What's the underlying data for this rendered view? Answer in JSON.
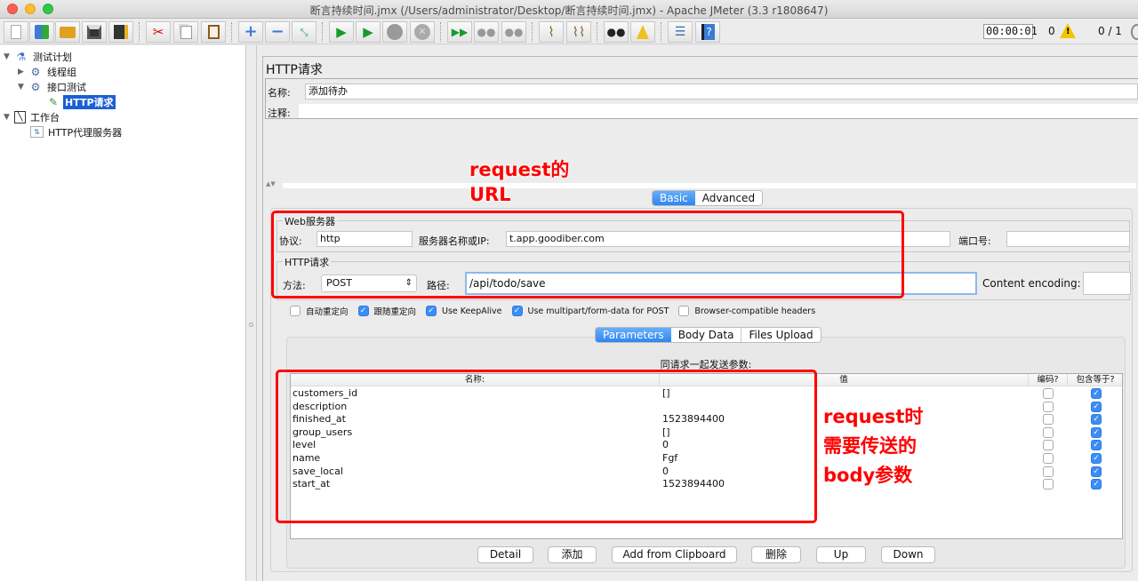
{
  "window": {
    "title": "断言持续时间.jmx (/Users/administrator/Desktop/断言持续时间.jmx) - Apache JMeter (3.3 r1808647)"
  },
  "toolbar": {
    "buttons": [
      {
        "name": "new",
        "icon": "new-document-icon"
      },
      {
        "name": "templates",
        "icon": "templates-icon"
      },
      {
        "name": "open",
        "icon": "open-folder-icon"
      },
      {
        "name": "save",
        "icon": "save-icon"
      },
      {
        "name": "save-as",
        "icon": "save-as-icon"
      },
      {
        "name": "cut",
        "icon": "scissors-icon"
      },
      {
        "name": "copy",
        "icon": "copy-icon"
      },
      {
        "name": "paste",
        "icon": "paste-icon"
      },
      {
        "name": "expand",
        "icon": "plus-icon"
      },
      {
        "name": "collapse",
        "icon": "minus-icon"
      },
      {
        "name": "toggle",
        "icon": "toggle-icon"
      },
      {
        "name": "start",
        "icon": "play-icon"
      },
      {
        "name": "start-no-pauses",
        "icon": "play-no-timers-icon"
      },
      {
        "name": "stop",
        "icon": "stop-icon"
      },
      {
        "name": "shutdown",
        "icon": "shutdown-icon"
      },
      {
        "name": "remote-start",
        "icon": "remote-start-icon"
      },
      {
        "name": "remote-stop",
        "icon": "remote-stop-icon"
      },
      {
        "name": "remote-shutdown",
        "icon": "remote-shutdown-icon"
      },
      {
        "name": "clear",
        "icon": "clear-icon"
      },
      {
        "name": "clear-all",
        "icon": "clear-all-icon"
      },
      {
        "name": "search",
        "icon": "binoculars-icon"
      },
      {
        "name": "reset-search",
        "icon": "broom-icon"
      },
      {
        "name": "function-helper",
        "icon": "function-list-icon"
      },
      {
        "name": "help",
        "icon": "help-icon"
      }
    ],
    "timer": "00:00:01",
    "error_count": "0",
    "warning_glyph": "!",
    "threads": "0 / 1"
  },
  "tree": {
    "nodes": [
      {
        "label": "测试计划",
        "icon": "flask-icon",
        "expanded": true,
        "level": 0
      },
      {
        "label": "线程组",
        "icon": "gear-icon",
        "expanded": false,
        "level": 1
      },
      {
        "label": "接口测试",
        "icon": "gear-icon",
        "expanded": true,
        "level": 1
      },
      {
        "label": "HTTP请求",
        "icon": "pipette-icon",
        "selected": true,
        "level": 2
      },
      {
        "label": "工作台",
        "icon": "workbench-icon",
        "expanded": true,
        "level": 0
      },
      {
        "label": "HTTP代理服务器",
        "icon": "proxy-icon",
        "level": 1
      }
    ]
  },
  "panel": {
    "title": "HTTP请求",
    "name_label": "名称:",
    "name_value": "添加待办",
    "comment_label": "注释:",
    "comment_value": "",
    "tabs": [
      {
        "label": "Basic",
        "active": true
      },
      {
        "label": "Advanced",
        "active": false
      }
    ],
    "web_server": {
      "group_title": "Web服务器",
      "protocol_label": "协议:",
      "protocol_value": "http",
      "server_label": "服务器名称或IP:",
      "server_value": "t.app.goodiber.com",
      "port_label": "端口号:",
      "port_value": ""
    },
    "http_request": {
      "group_title": "HTTP请求",
      "method_label": "方法:",
      "method_value": "POST",
      "path_label": "路径:",
      "path_value": "/api/todo/save",
      "encoding_label": "Content encoding:",
      "encoding_value": ""
    },
    "options": [
      {
        "label": "自动重定向",
        "checked": false
      },
      {
        "label": "跟随重定向",
        "checked": true
      },
      {
        "label": "Use KeepAlive",
        "checked": true
      },
      {
        "label": "Use multipart/form-data for POST",
        "checked": true
      },
      {
        "label": "Browser-compatible headers",
        "checked": false
      }
    ],
    "sub_tabs": [
      {
        "label": "Parameters",
        "active": true
      },
      {
        "label": "Body Data",
        "active": false
      },
      {
        "label": "Files Upload",
        "active": false
      }
    ],
    "params_caption": "同请求一起发送参数:",
    "columns": [
      "名称:",
      "值",
      "编码?",
      "包含等于?"
    ],
    "rows": [
      {
        "name": "customers_id",
        "value": "[]",
        "encode": false,
        "include_equals": true
      },
      {
        "name": "description",
        "value": "",
        "encode": false,
        "include_equals": true
      },
      {
        "name": "finished_at",
        "value": "1523894400",
        "encode": false,
        "include_equals": true
      },
      {
        "name": "group_users",
        "value": "[]",
        "encode": false,
        "include_equals": true
      },
      {
        "name": "level",
        "value": "0",
        "encode": false,
        "include_equals": true
      },
      {
        "name": "name",
        "value": "Fgf",
        "encode": false,
        "include_equals": true
      },
      {
        "name": "save_local",
        "value": "0",
        "encode": false,
        "include_equals": true
      },
      {
        "name": "start_at",
        "value": "1523894400",
        "encode": false,
        "include_equals": true
      }
    ],
    "buttons": [
      "Detail",
      "添加",
      "Add from Clipboard",
      "删除",
      "Up",
      "Down"
    ]
  },
  "annotations": {
    "url_note": [
      "request的",
      "URL"
    ],
    "body_note": [
      "request时",
      "需要传送的",
      "body参数"
    ],
    "color": "#ff0000"
  },
  "check_glyph": "✓"
}
